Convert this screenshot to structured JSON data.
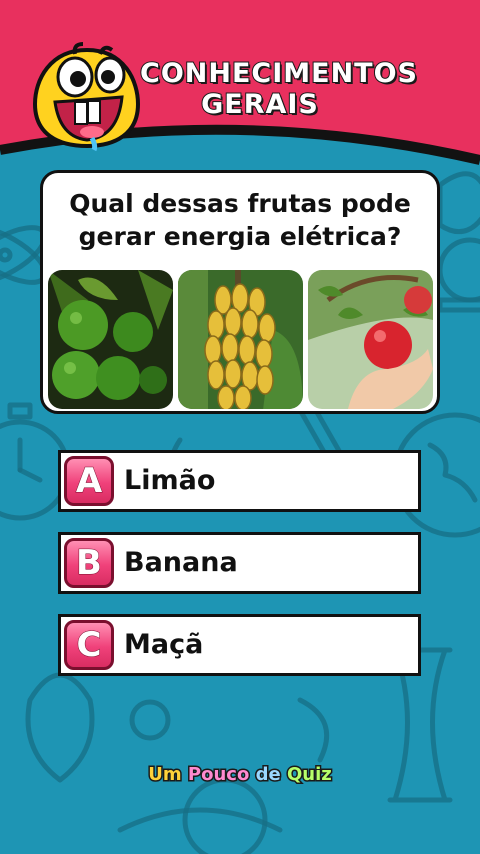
{
  "header": {
    "title_line1": "CONHECIMENTOS",
    "title_line2": "GERAIS",
    "colors": {
      "banner": "#e8305e",
      "mascot": "#ffd21f"
    }
  },
  "question": {
    "text": "Qual dessas frutas  pode\ngerar energia elétrica?",
    "images": [
      {
        "icon": "limes-photo"
      },
      {
        "icon": "bananas-photo"
      },
      {
        "icon": "apple-photo"
      }
    ]
  },
  "answers": [
    {
      "letter": "A",
      "label": "Limão"
    },
    {
      "letter": "B",
      "label": "Banana"
    },
    {
      "letter": "C",
      "label": "Maçã"
    }
  ],
  "brand": {
    "w1": "Um",
    "w2": "Pouco",
    "w3": "de",
    "w4": "Quiz"
  },
  "colors": {
    "background": "#1e95b4",
    "answer_badge": "#f0417a"
  }
}
